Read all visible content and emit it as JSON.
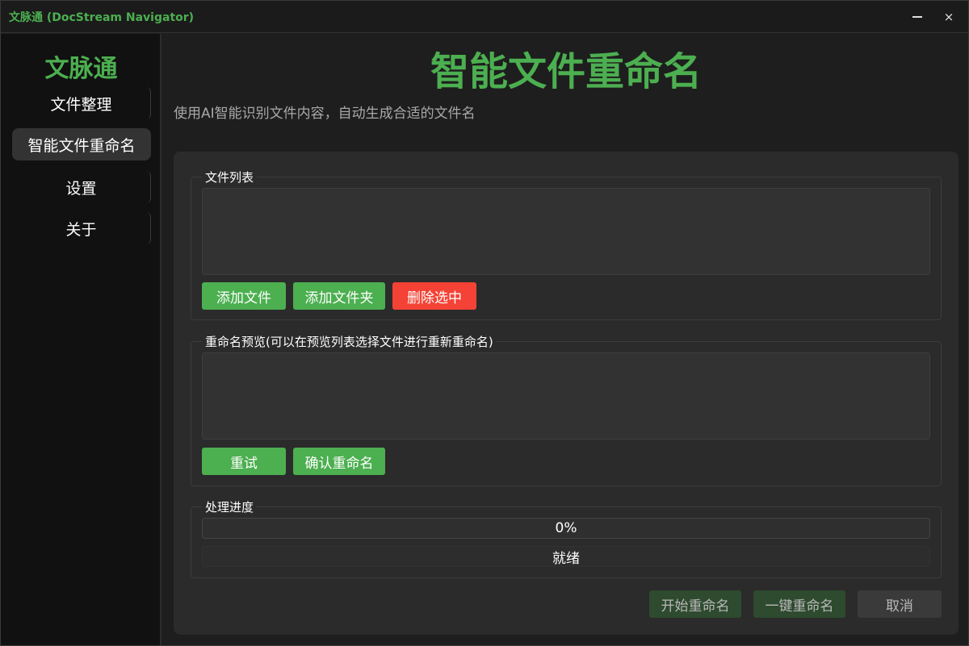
{
  "window": {
    "title": "文脉通 (DocStream Navigator)",
    "minimize_icon": "minimize-icon",
    "close_glyph": "×"
  },
  "sidebar": {
    "brand": "文脉通",
    "items": [
      {
        "label": "文件整理",
        "active": false
      },
      {
        "label": "智能文件重命名",
        "active": true
      },
      {
        "label": "设置",
        "active": false
      },
      {
        "label": "关于",
        "active": false
      }
    ]
  },
  "main": {
    "title": "智能文件重命名",
    "subtitle": "使用AI智能识别文件内容，自动生成合适的文件名"
  },
  "file_list": {
    "label": "文件列表",
    "add_file": "添加文件",
    "add_folder": "添加文件夹",
    "delete_selected": "删除选中"
  },
  "preview": {
    "label": "重命名预览(可以在预览列表选择文件进行重新重命名)",
    "retry": "重试",
    "confirm_rename": "确认重命名"
  },
  "progress": {
    "label": "处理进度",
    "value_text": "0%",
    "value": 0,
    "status": "就绪"
  },
  "actions": {
    "start_rename": "开始重命名",
    "one_click_rename": "一键重命名",
    "cancel": "取消"
  },
  "colors": {
    "accent": "#4caf50",
    "danger": "#f44336",
    "background": "#1e1e1e",
    "panel": "#2b2b2b"
  }
}
